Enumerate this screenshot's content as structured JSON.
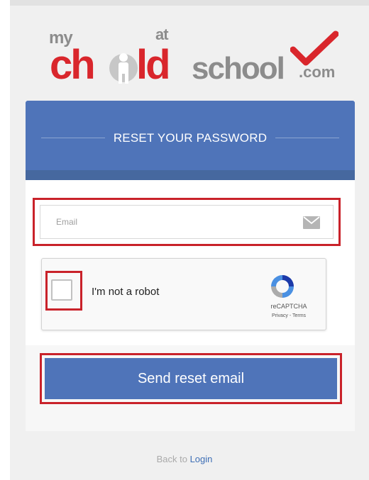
{
  "logo": {
    "my": "my",
    "ch": "ch",
    "ld": "ld",
    "at": "at",
    "school": "school",
    "com": ".com"
  },
  "header": {
    "title": "RESET YOUR PASSWORD"
  },
  "form": {
    "email_placeholder": "Email",
    "email_value": ""
  },
  "recaptcha": {
    "label": "I'm not a robot",
    "brand": "reCAPTCHA",
    "links": "Privacy - Terms",
    "checked": false
  },
  "actions": {
    "send_label": "Send reset email"
  },
  "footer": {
    "back_prefix": "Back to",
    "login_label": "Login"
  },
  "colors": {
    "primary": "#4f74b9",
    "brand_red": "#d9262c",
    "highlight_red": "#c9222a",
    "logo_grey": "#8c8c8c"
  },
  "icons": [
    "envelope-icon",
    "recaptcha-logo-icon",
    "checkmark-icon",
    "child-figure-icon"
  ]
}
